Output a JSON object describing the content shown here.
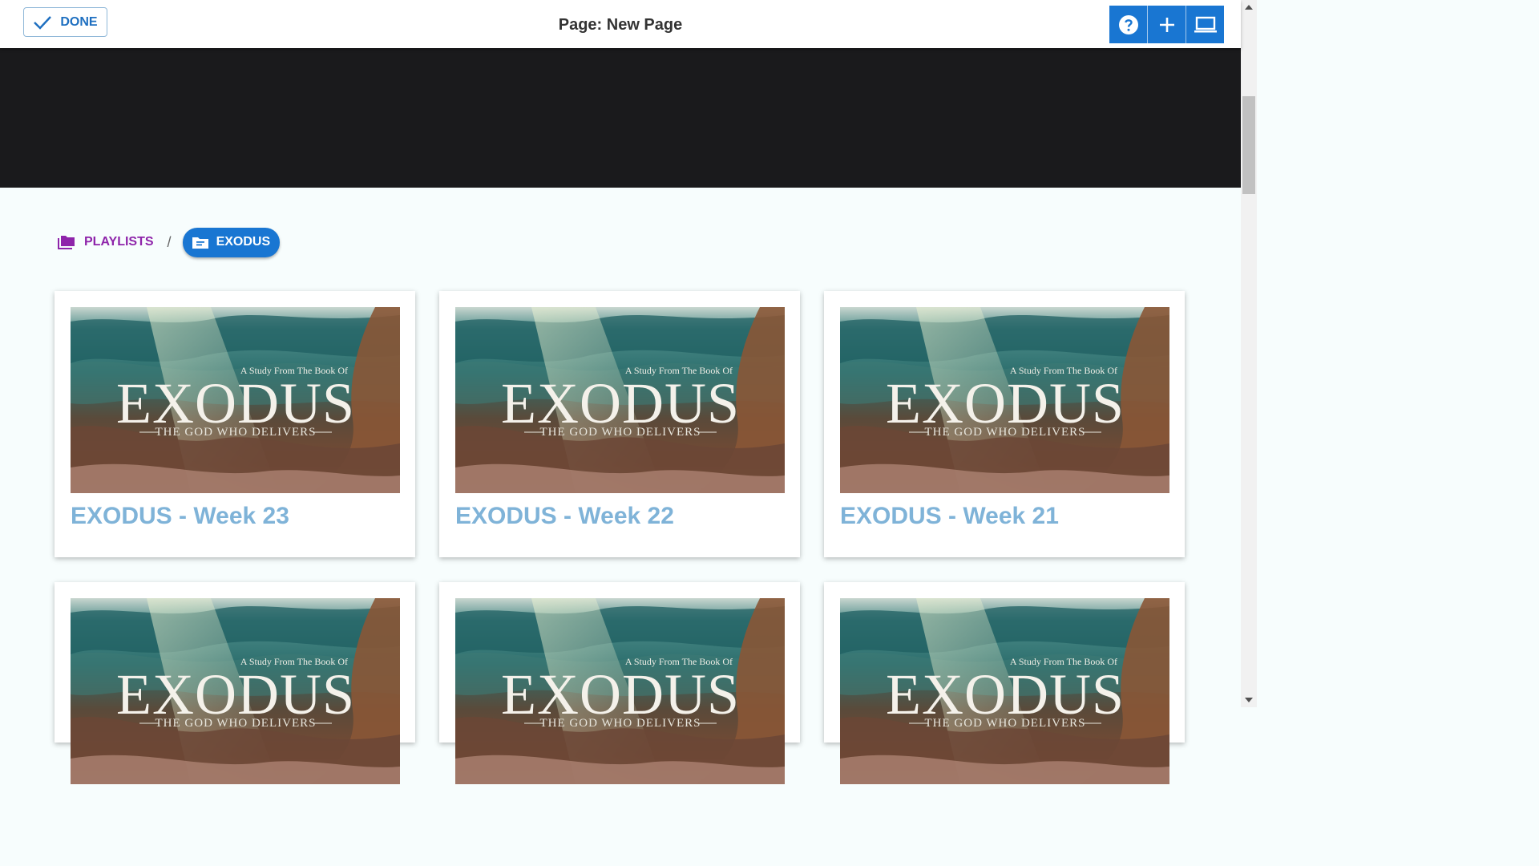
{
  "toolbar": {
    "done_label": "DONE",
    "page_title": "Page: New Page",
    "icons": [
      "help-icon",
      "add-icon",
      "laptop-icon"
    ],
    "accent": "#1976d2"
  },
  "breadcrumb": {
    "playlists_label": "PLAYLISTS",
    "separator": "/",
    "current_label": "EXODUS",
    "playlists_color": "#8e24aa"
  },
  "thumbnail": {
    "subtitle": "A Study From The Book Of",
    "title": "EXODUS",
    "tagline": "THE GOD WHO DELIVERS"
  },
  "cards": [
    {
      "title": "EXODUS - Week 23"
    },
    {
      "title": "EXODUS - Week 22"
    },
    {
      "title": "EXODUS - Week 21"
    },
    {
      "title": ""
    },
    {
      "title": ""
    },
    {
      "title": ""
    }
  ]
}
